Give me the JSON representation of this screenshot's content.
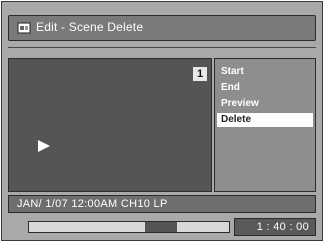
{
  "title": {
    "text": "Edit - Scene Delete",
    "icon": "edit-scene-icon"
  },
  "preview": {
    "chapter_number": "1",
    "play_icon": "play-icon"
  },
  "menu": {
    "items": [
      {
        "label": "Start"
      },
      {
        "label": "End"
      },
      {
        "label": "Preview"
      },
      {
        "label": "Delete"
      }
    ],
    "selected_index": 3
  },
  "status": {
    "text": "JAN/ 1/07 12:00AM CH10   LP"
  },
  "progress": {
    "position_fraction": 0.58,
    "segment_fraction": 0.16
  },
  "time": {
    "text": "1 : 40 : 00"
  },
  "colors": {
    "highlight": "#ffffff",
    "background": "#a9a9a9"
  }
}
